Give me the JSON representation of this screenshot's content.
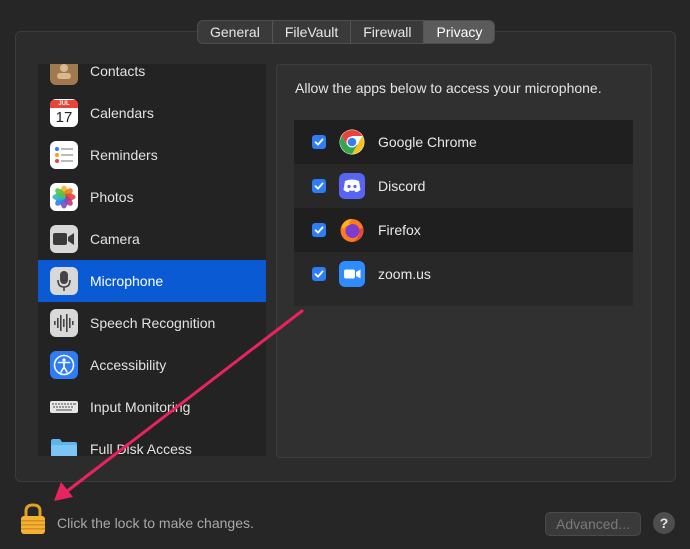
{
  "tabs": [
    {
      "label": "General"
    },
    {
      "label": "FileVault"
    },
    {
      "label": "Firewall"
    },
    {
      "label": "Privacy"
    }
  ],
  "active_tab": "Privacy",
  "sidebar": {
    "items": [
      {
        "label": "Contacts",
        "icon": "contacts-icon"
      },
      {
        "label": "Calendars",
        "icon": "calendar-icon",
        "icon_text_month": "JUL",
        "icon_text_day": "17"
      },
      {
        "label": "Reminders",
        "icon": "reminders-icon"
      },
      {
        "label": "Photos",
        "icon": "photos-icon"
      },
      {
        "label": "Camera",
        "icon": "camera-icon"
      },
      {
        "label": "Microphone",
        "icon": "microphone-icon",
        "selected": true
      },
      {
        "label": "Speech Recognition",
        "icon": "speech-waveform-icon"
      },
      {
        "label": "Accessibility",
        "icon": "accessibility-icon"
      },
      {
        "label": "Input Monitoring",
        "icon": "keyboard-icon"
      },
      {
        "label": "Full Disk Access",
        "icon": "folder-icon"
      }
    ]
  },
  "detail": {
    "heading": "Allow the apps below to access your microphone.",
    "apps": [
      {
        "label": "Google Chrome",
        "icon": "chrome-icon",
        "checked": true
      },
      {
        "label": "Discord",
        "icon": "discord-icon",
        "checked": true
      },
      {
        "label": "Firefox",
        "icon": "firefox-icon",
        "checked": true
      },
      {
        "label": "zoom.us",
        "icon": "zoom-icon",
        "checked": true
      }
    ]
  },
  "footer": {
    "lock_text": "Click the lock to make changes.",
    "advanced_label": "Advanced...",
    "help_label": "?"
  },
  "annotation": {
    "color": "#e8245f"
  },
  "colors": {
    "selection": "#0a5bd3",
    "checkbox": "#2f7df6"
  }
}
